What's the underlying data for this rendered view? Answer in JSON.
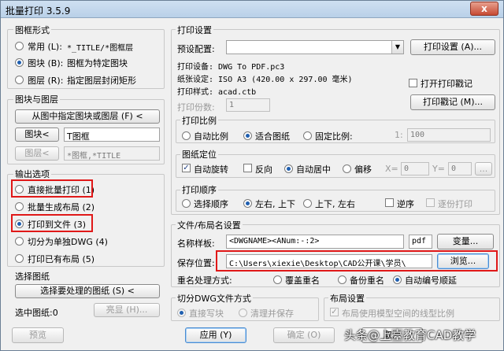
{
  "window": {
    "title": "批量打印 3.5.9",
    "close": "x"
  },
  "frame_style": {
    "title": "图框形式",
    "options": [
      {
        "label": "常用 (L):",
        "desc": "*_TITLE/*图框层"
      },
      {
        "label": "图块 (B):",
        "desc": "图框为特定图块"
      },
      {
        "label": "图层 (R):",
        "desc": "指定图层封闭矩形"
      }
    ]
  },
  "block_layer": {
    "title": "图块与图层",
    "pick_button": "从图中指定图块或图层 (F) <",
    "block_button": "图块<",
    "block_value": "T图框",
    "layer_button": "图层<",
    "layer_value": "*图框,*TITLE"
  },
  "output": {
    "title": "输出选项",
    "options": [
      "直接批量打印 (1)",
      "批量生成布局 (2)",
      "打印到文件 (3)",
      "切分为单独DWG (4)",
      "打印已有布局 (5)"
    ]
  },
  "select_drawings": {
    "title": "选择图纸",
    "button": "选择要处理的图纸 (S) <",
    "count_label": "选中图纸:0",
    "highlight_button": "亮显 (H)..."
  },
  "print_settings": {
    "title": "打印设置",
    "preset_label": "预设配置:",
    "preset_value": "",
    "print_setup_button": "打印设置 (A)...",
    "device": "打印设备: DWG To PDF.pc3",
    "paper": "纸张设定: ISO A3 (420.00 x 297.00 毫米)",
    "style": "打印样式: acad.ctb",
    "open_stamp": "打开打印戳记",
    "stamp_button": "打印戳记 (M)...",
    "copies_label": "打印份数:",
    "copies_value": "1"
  },
  "scale": {
    "title": "打印比例",
    "options": [
      "自动比例",
      "适合图纸",
      "固定比例:"
    ],
    "fixed_prefix": "1:",
    "fixed_value": "100"
  },
  "position": {
    "title": "图纸定位",
    "auto_rotate": "自动旋转",
    "reverse": "反向",
    "auto_center": "自动居中",
    "offset": "偏移",
    "x_label": "X=",
    "x_value": "0",
    "y_label": "Y=",
    "y_value": "0",
    "dots": "..."
  },
  "order": {
    "title": "打印顺序",
    "options": [
      "选择顺序",
      "左右, 上下",
      "上下, 左右"
    ],
    "reverse": "逆序",
    "batch": "逐份打印"
  },
  "file_naming": {
    "title": "文件/布局名设置",
    "name_label": "名称样板:",
    "name_value": "<DWGNAME><ANum:-:2>",
    "ext_value": "pdf",
    "vars_button": "变量...",
    "save_label": "保存位置:",
    "save_value": "C:\\Users\\xiexie\\Desktop\\CAD公开课\\学员\\",
    "browse_button": "浏览...",
    "dup_label": "重名处理方式:",
    "dup_options": [
      "覆盖重名",
      "备份重名",
      "自动编号顺延"
    ]
  },
  "split": {
    "title": "切分DWG文件方式",
    "options": [
      "直接写块",
      "清理并保存"
    ]
  },
  "layout": {
    "title": "布局设置",
    "model_linetype": "布局使用模型空间的线型比例"
  },
  "footer": {
    "preview": "预览",
    "apply": "应用 (Y)",
    "ok": "确定 (O)",
    "cancel": "取消"
  },
  "watermark": "头条@上臺教育CAD教学"
}
